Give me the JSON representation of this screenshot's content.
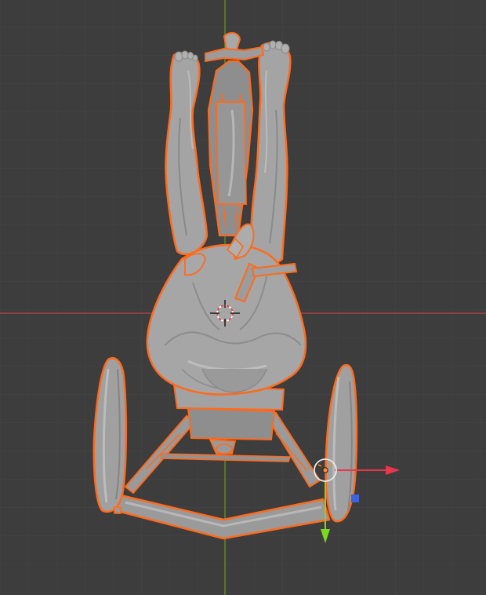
{
  "viewport": {
    "background": "#3d3d3d",
    "grid_minor_color": "#454545",
    "grid_major_color": "#4a4a4a",
    "x_axis_color": "#b5454a",
    "y_axis_color": "#6c9a1e"
  },
  "scene": {
    "mesh_color": "#9e9e9e",
    "mesh_shade": "#8a8a8a",
    "mesh_light": "#b4b4b4",
    "selection_outline_color": "#ff6a1c"
  },
  "gizmo": {
    "x_arrow_color": "#e8364a",
    "y_arrow_color": "#7cd81e",
    "z_handle_color": "#3c64e0",
    "ring_color": "#e8e8e8"
  },
  "icons": [
    "3d-cursor-icon",
    "object-origin-icon",
    "move-gizmo-icon"
  ]
}
